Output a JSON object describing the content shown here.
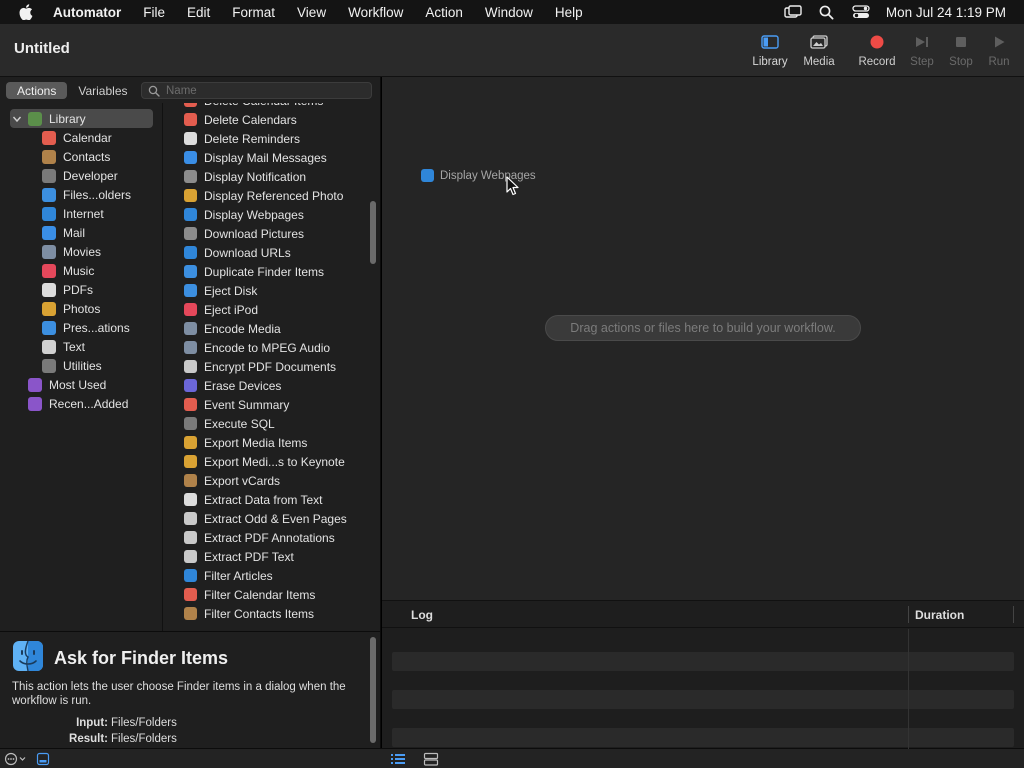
{
  "menubar": {
    "app_name": "Automator",
    "items": [
      "File",
      "Edit",
      "Format",
      "View",
      "Workflow",
      "Action",
      "Window",
      "Help"
    ],
    "clock": "Mon Jul 24  1:19 PM"
  },
  "window": {
    "title": "Untitled",
    "toolbar": {
      "library": "Library",
      "media": "Media",
      "record": "Record",
      "step": "Step",
      "stop": "Stop",
      "run": "Run"
    }
  },
  "left": {
    "tabs": {
      "actions": "Actions",
      "variables": "Variables"
    },
    "search_placeholder": "Name",
    "library": [
      {
        "label": "Library",
        "color": "#5b8f4a",
        "selected": true
      },
      {
        "label": "Calendar",
        "color": "#e35d4f"
      },
      {
        "label": "Contacts",
        "color": "#b0824a"
      },
      {
        "label": "Developer",
        "color": "#7a7a7a"
      },
      {
        "label": "Files...olders",
        "color": "#3c8fe0"
      },
      {
        "label": "Internet",
        "color": "#2f86d9"
      },
      {
        "label": "Mail",
        "color": "#3a8ee6"
      },
      {
        "label": "Movies",
        "color": "#7e8ea3"
      },
      {
        "label": "Music",
        "color": "#e5485b"
      },
      {
        "label": "PDFs",
        "color": "#dcdcdc"
      },
      {
        "label": "Photos",
        "color": "#d9a233"
      },
      {
        "label": "Pres...ations",
        "color": "#3c8fe0"
      },
      {
        "label": "Text",
        "color": "#d0d0d0"
      },
      {
        "label": "Utilities",
        "color": "#7a7a7a"
      },
      {
        "label": "Most Used",
        "color": "#8a55c9"
      },
      {
        "label": "Recen...Added",
        "color": "#8a55c9"
      }
    ],
    "actions": [
      {
        "label": "Delete Calendar Items",
        "color": "#e35d4f"
      },
      {
        "label": "Delete Calendars",
        "color": "#e35d4f"
      },
      {
        "label": "Delete Reminders",
        "color": "#dcdcdc"
      },
      {
        "label": "Display Mail Messages",
        "color": "#3a8ee6"
      },
      {
        "label": "Display Notification",
        "color": "#8c8c8c"
      },
      {
        "label": "Display Referenced Photo",
        "color": "#d9a233"
      },
      {
        "label": "Display Webpages",
        "color": "#2f86d9"
      },
      {
        "label": "Download Pictures",
        "color": "#8c8c8c"
      },
      {
        "label": "Download URLs",
        "color": "#2f86d9"
      },
      {
        "label": "Duplicate Finder Items",
        "color": "#3c8fe0"
      },
      {
        "label": "Eject Disk",
        "color": "#3c8fe0"
      },
      {
        "label": "Eject iPod",
        "color": "#e5485b"
      },
      {
        "label": "Encode Media",
        "color": "#7e8ea3"
      },
      {
        "label": "Encode to MPEG Audio",
        "color": "#7e8ea3"
      },
      {
        "label": "Encrypt PDF Documents",
        "color": "#c9c9c9"
      },
      {
        "label": "Erase Devices",
        "color": "#6b66d8"
      },
      {
        "label": "Event Summary",
        "color": "#e35d4f"
      },
      {
        "label": "Execute SQL",
        "color": "#7a7a7a"
      },
      {
        "label": "Export Media Items",
        "color": "#d9a233"
      },
      {
        "label": "Export Medi...s to Keynote",
        "color": "#d9a233"
      },
      {
        "label": "Export vCards",
        "color": "#b0824a"
      },
      {
        "label": "Extract Data from Text",
        "color": "#dcdcdc"
      },
      {
        "label": "Extract Odd & Even Pages",
        "color": "#c9c9c9"
      },
      {
        "label": "Extract PDF Annotations",
        "color": "#c9c9c9"
      },
      {
        "label": "Extract PDF Text",
        "color": "#c9c9c9"
      },
      {
        "label": "Filter Articles",
        "color": "#2f86d9"
      },
      {
        "label": "Filter Calendar Items",
        "color": "#e35d4f"
      },
      {
        "label": "Filter Contacts Items",
        "color": "#b0824a"
      }
    ]
  },
  "description": {
    "title": "Ask for Finder Items",
    "text": "This action lets the user choose Finder items in a dialog when the workflow is run.",
    "input_label": "Input:",
    "input_value": "Files/Folders",
    "result_label": "Result:",
    "result_value": "Files/Folders"
  },
  "workflow": {
    "drag_item": "Display Webpages",
    "hint": "Drag actions or files here to build your workflow."
  },
  "log": {
    "col_log": "Log",
    "col_duration": "Duration"
  }
}
